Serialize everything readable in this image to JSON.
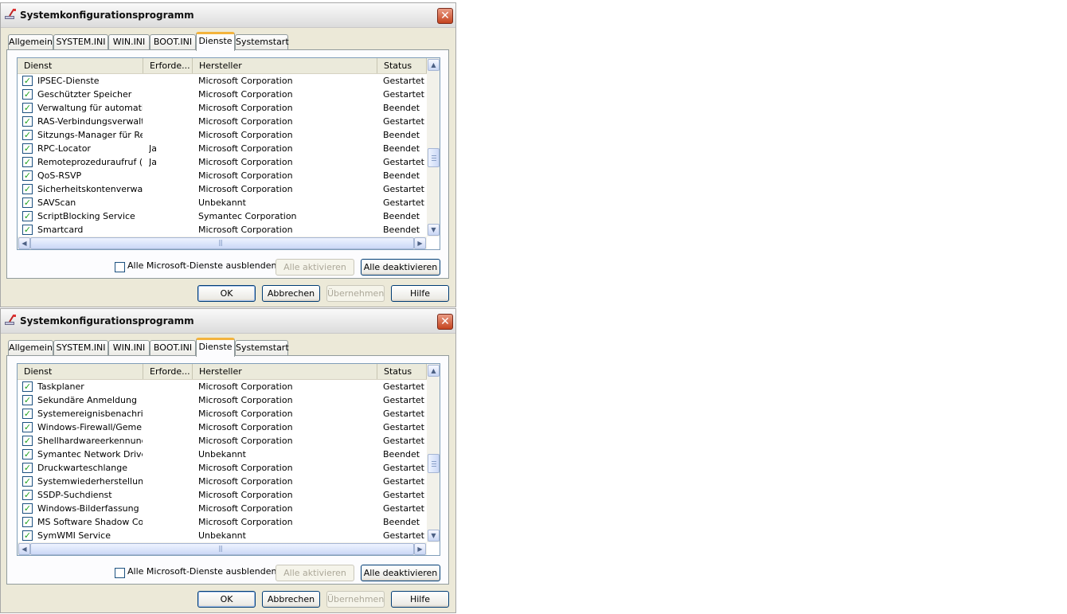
{
  "windows": [
    {
      "title": "Systemkonfigurationsprogramm",
      "close_glyph": "✕",
      "tabs": [
        "Allgemein",
        "SYSTEM.INI",
        "WIN.INI",
        "BOOT.INI",
        "Dienste",
        "Systemstart"
      ],
      "active_tab": "Dienste",
      "columns": [
        "Dienst",
        "Erforde...",
        "Hersteller",
        "Status"
      ],
      "rows": [
        {
          "name": "IPSEC-Dienste",
          "required": "",
          "vendor": "Microsoft Corporation",
          "status": "Gestartet",
          "checked": true
        },
        {
          "name": "Geschützter Speicher",
          "required": "",
          "vendor": "Microsoft Corporation",
          "status": "Gestartet",
          "checked": true
        },
        {
          "name": "Verwaltung für automati...",
          "required": "",
          "vendor": "Microsoft Corporation",
          "status": "Beendet",
          "checked": true
        },
        {
          "name": "RAS-Verbindungsverwalt...",
          "required": "",
          "vendor": "Microsoft Corporation",
          "status": "Gestartet",
          "checked": true
        },
        {
          "name": "Sitzungs-Manager für Re...",
          "required": "",
          "vendor": "Microsoft Corporation",
          "status": "Beendet",
          "checked": true
        },
        {
          "name": "RPC-Locator",
          "required": "Ja",
          "vendor": "Microsoft Corporation",
          "status": "Beendet",
          "checked": true
        },
        {
          "name": "Remoteprozeduraufruf (...",
          "required": "Ja",
          "vendor": "Microsoft Corporation",
          "status": "Gestartet",
          "checked": true
        },
        {
          "name": "QoS-RSVP",
          "required": "",
          "vendor": "Microsoft Corporation",
          "status": "Beendet",
          "checked": true
        },
        {
          "name": "Sicherheitskontenverwal...",
          "required": "",
          "vendor": "Microsoft Corporation",
          "status": "Gestartet",
          "checked": true
        },
        {
          "name": "SAVScan",
          "required": "",
          "vendor": "Unbekannt",
          "status": "Gestartet",
          "checked": true
        },
        {
          "name": "ScriptBlocking Service",
          "required": "",
          "vendor": "Symantec Corporation",
          "status": "Beendet",
          "checked": true
        },
        {
          "name": "Smartcard",
          "required": "",
          "vendor": "Microsoft Corporation",
          "status": "Beendet",
          "checked": true
        }
      ],
      "hide_ms_label": "Alle Microsoft-Dienste ausblenden",
      "hide_ms_checked": false,
      "enable_all_label": "Alle aktivieren",
      "disable_all_label": "Alle deaktivieren",
      "ok_label": "OK",
      "cancel_label": "Abbrechen",
      "apply_label": "Übernehmen",
      "help_label": "Hilfe"
    },
    {
      "title": "Systemkonfigurationsprogramm",
      "close_glyph": "✕",
      "tabs": [
        "Allgemein",
        "SYSTEM.INI",
        "WIN.INI",
        "BOOT.INI",
        "Dienste",
        "Systemstart"
      ],
      "active_tab": "Dienste",
      "columns": [
        "Dienst",
        "Erforde...",
        "Hersteller",
        "Status"
      ],
      "rows": [
        {
          "name": "Taskplaner",
          "required": "",
          "vendor": "Microsoft Corporation",
          "status": "Gestartet",
          "checked": true
        },
        {
          "name": "Sekundäre Anmeldung",
          "required": "",
          "vendor": "Microsoft Corporation",
          "status": "Gestartet",
          "checked": true
        },
        {
          "name": "Systemereignisbenachric...",
          "required": "",
          "vendor": "Microsoft Corporation",
          "status": "Gestartet",
          "checked": true
        },
        {
          "name": "Windows-Firewall/Gemei...",
          "required": "",
          "vendor": "Microsoft Corporation",
          "status": "Gestartet",
          "checked": true
        },
        {
          "name": "Shellhardwareerkennung",
          "required": "",
          "vendor": "Microsoft Corporation",
          "status": "Gestartet",
          "checked": true
        },
        {
          "name": "Symantec Network Drive...",
          "required": "",
          "vendor": "Unbekannt",
          "status": "Beendet",
          "checked": true
        },
        {
          "name": "Druckwarteschlange",
          "required": "",
          "vendor": "Microsoft Corporation",
          "status": "Gestartet",
          "checked": true
        },
        {
          "name": "Systemwiederherstellun...",
          "required": "",
          "vendor": "Microsoft Corporation",
          "status": "Gestartet",
          "checked": true
        },
        {
          "name": "SSDP-Suchdienst",
          "required": "",
          "vendor": "Microsoft Corporation",
          "status": "Gestartet",
          "checked": true
        },
        {
          "name": "Windows-Bilderfassung (...",
          "required": "",
          "vendor": "Microsoft Corporation",
          "status": "Gestartet",
          "checked": true
        },
        {
          "name": "MS Software Shadow Co...",
          "required": "",
          "vendor": "Microsoft Corporation",
          "status": "Beendet",
          "checked": true
        },
        {
          "name": "SymWMI Service",
          "required": "",
          "vendor": "Unbekannt",
          "status": "Gestartet",
          "checked": true
        }
      ],
      "hide_ms_label": "Alle Microsoft-Dienste ausblenden",
      "hide_ms_checked": false,
      "enable_all_label": "Alle aktivieren",
      "disable_all_label": "Alle deaktivieren",
      "ok_label": "OK",
      "cancel_label": "Abbrechen",
      "apply_label": "Übernehmen",
      "help_label": "Hilfe"
    }
  ]
}
